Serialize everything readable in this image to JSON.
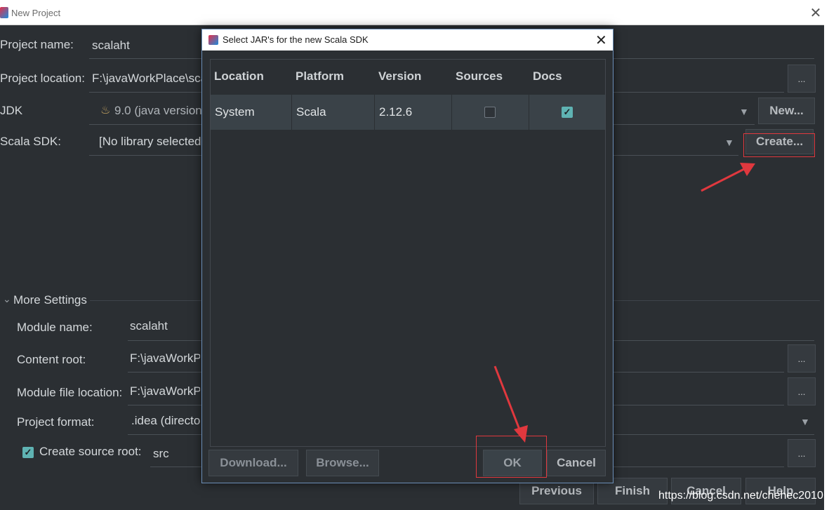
{
  "window": {
    "title": "New Project"
  },
  "form": {
    "project_name_label": "Project name:",
    "project_name_value": "scalaht",
    "project_location_label": "Project location:",
    "project_location_value": "F:\\javaWorkPlace\\sca",
    "jdk_label": "JDK",
    "jdk_value": "9.0 (java version",
    "jdk_new_button": "New...",
    "scala_sdk_label": "Scala SDK:",
    "scala_sdk_value": "[No library selected",
    "scala_sdk_create_button": "Create...",
    "browse_dots": "...",
    "more_settings_label": "More Settings",
    "module_name_label": "Module name:",
    "module_name_value": "scalaht",
    "content_root_label": "Content root:",
    "content_root_value": "F:\\javaWorkP",
    "module_file_location_label": "Module file location:",
    "module_file_location_value": "F:\\javaWorkP",
    "project_format_label": "Project format:",
    "project_format_value": ".idea (directo",
    "create_source_root_label": "Create source root:",
    "create_source_root_value": "src",
    "create_source_root_checked": true
  },
  "footer": {
    "previous": "Previous",
    "finish": "Finish",
    "cancel": "Cancel",
    "help": "Help"
  },
  "dialog": {
    "title": "Select JAR's for the new Scala SDK",
    "columns": [
      "Location",
      "Platform",
      "Version",
      "Sources",
      "Docs"
    ],
    "rows": [
      {
        "location": "System",
        "platform": "Scala",
        "version": "2.12.6",
        "sources": false,
        "docs": true
      }
    ],
    "download_button": "Download...",
    "browse_button": "Browse...",
    "ok_button": "OK",
    "cancel_button": "Cancel"
  },
  "watermark": "https://blog.csdn.net/chehec2010",
  "colors": {
    "background": "#2b2f33",
    "annotation_red": "#e0383e",
    "checkbox_teal": "#5fb3b3"
  }
}
